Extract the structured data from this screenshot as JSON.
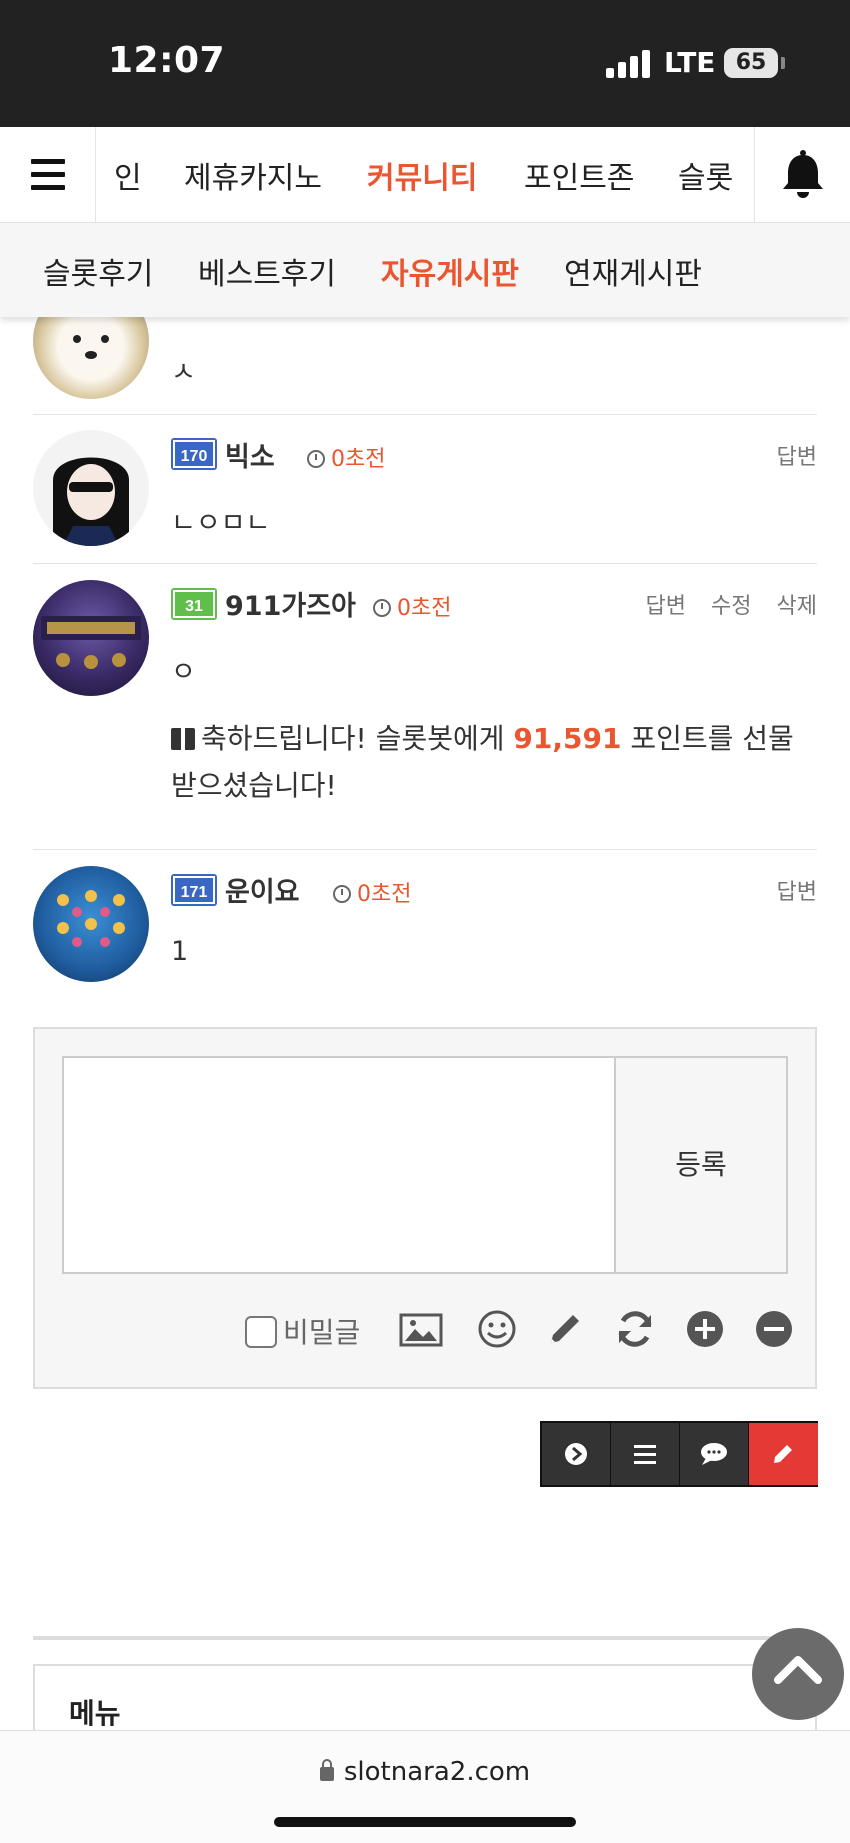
{
  "status_bar": {
    "time": "12:07",
    "network": "LTE",
    "battery": "65"
  },
  "main_nav": {
    "items": [
      {
        "label": "인"
      },
      {
        "label": "제휴카지노"
      },
      {
        "label": "커뮤니티"
      },
      {
        "label": "포인트존"
      },
      {
        "label": "슬롯"
      }
    ],
    "active_color": "#e9562f"
  },
  "sub_nav": {
    "items": [
      {
        "label": "슬롯후기"
      },
      {
        "label": "베스트후기"
      },
      {
        "label": "자유게시판"
      },
      {
        "label": "연재게시판"
      }
    ]
  },
  "comments": [
    {
      "text": "ㅅ"
    },
    {
      "nickname": "빅소",
      "level": "170",
      "time": "0초전",
      "text": "ㄴㅇㅁㄴ",
      "actions": [
        "답변"
      ]
    },
    {
      "nickname": "911가즈아",
      "level": "31",
      "time": "0초전",
      "text": "ㅇ",
      "actions": [
        "답변",
        "수정",
        "삭제"
      ],
      "gift": {
        "prefix": "축하드립니다! 슬롯봇에게 ",
        "points": "91,591",
        "suffix": " 포인트를 선물받으셨습니다!"
      }
    },
    {
      "nickname": "운이요",
      "level": "171",
      "time": "0초전",
      "text": "1",
      "actions": [
        "답변"
      ]
    }
  ],
  "comment_form": {
    "submit_label": "등록",
    "secret_label": "비밀글",
    "tools": [
      "image-icon",
      "emoji-icon",
      "pencil-icon",
      "refresh-icon",
      "plus-circle-icon",
      "minus-circle-icon"
    ]
  },
  "footer": {
    "menu_title": "메뉴"
  },
  "browser": {
    "url": "slotnara2.com"
  }
}
